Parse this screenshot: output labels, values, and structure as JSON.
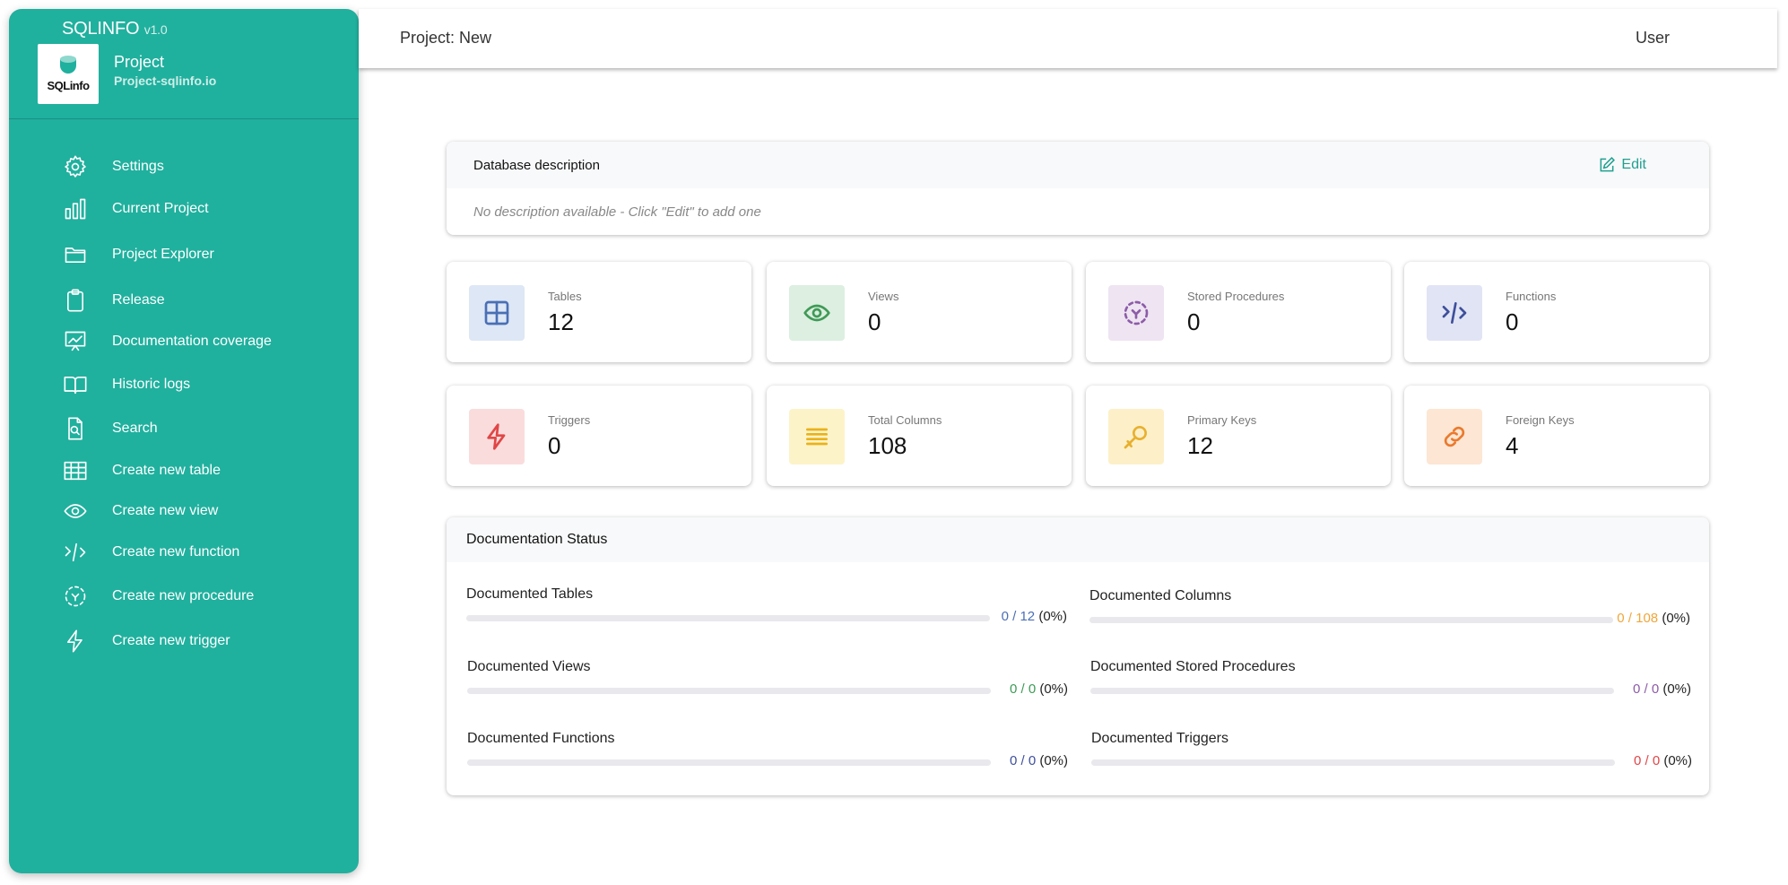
{
  "sidebar": {
    "brand": "SQLINFO",
    "version": "v1.0",
    "logo_text": "SQLinfo",
    "project_name": "Project",
    "project_sub": "Project-sqlinfo.io",
    "items": [
      {
        "label": "Settings",
        "icon": "gear-icon"
      },
      {
        "label": "Current Project",
        "icon": "bar-chart-icon"
      },
      {
        "label": "Project Explorer",
        "icon": "folder-icon"
      },
      {
        "label": "Release",
        "icon": "clipboard-icon"
      },
      {
        "label": "Documentation coverage",
        "icon": "presentation-chart-icon"
      },
      {
        "label": "Historic logs",
        "icon": "book-icon"
      },
      {
        "label": "Search",
        "icon": "file-search-icon"
      },
      {
        "label": "Create new table",
        "icon": "table-icon"
      },
      {
        "label": "Create new view",
        "icon": "eye-icon"
      },
      {
        "label": "Create new function",
        "icon": "code-icon"
      },
      {
        "label": "Create new procedure",
        "icon": "dashed-frame-icon"
      },
      {
        "label": "Create new trigger",
        "icon": "lightning-icon"
      }
    ]
  },
  "header": {
    "title": "Project: New",
    "user": "User"
  },
  "description": {
    "title": "Database description",
    "edit_label": "Edit",
    "empty_text": "No description available - Click \"Edit\" to add one"
  },
  "stats": [
    {
      "label": "Tables",
      "value": "12",
      "icon": "table-icon",
      "color": "#4a6fb5",
      "bg": "#dde7f5"
    },
    {
      "label": "Views",
      "value": "0",
      "icon": "eye-icon",
      "color": "#3f9a57",
      "bg": "#dcefe0"
    },
    {
      "label": "Stored Procedures",
      "value": "0",
      "icon": "dashed-frame-icon",
      "color": "#8c5ca8",
      "bg": "#efe4f2"
    },
    {
      "label": "Functions",
      "value": "0",
      "icon": "code-icon",
      "color": "#3e4f9c",
      "bg": "#e1e4f4"
    },
    {
      "label": "Triggers",
      "value": "0",
      "icon": "lightning-icon",
      "color": "#e04646",
      "bg": "#fadcdc"
    },
    {
      "label": "Total Columns",
      "value": "108",
      "icon": "lines-icon",
      "color": "#e8b21a",
      "bg": "#fdf3c9"
    },
    {
      "label": "Primary Keys",
      "value": "12",
      "icon": "key-icon",
      "color": "#e8b030",
      "bg": "#fdf0c8"
    },
    {
      "label": "Foreign Keys",
      "value": "4",
      "icon": "link-icon",
      "color": "#ea7a2e",
      "bg": "#fde6d3"
    }
  ],
  "doc_status": {
    "title": "Documentation Status",
    "items": [
      {
        "label": "Documented Tables",
        "count": "0 / 12",
        "pct": "(0%)",
        "progress": 0,
        "color": "#4a6fb5"
      },
      {
        "label": "Documented Columns",
        "count": "0 / 108",
        "pct": "(0%)",
        "progress": 0,
        "color": "#f0a63a"
      },
      {
        "label": "Documented Views",
        "count": "0 / 0",
        "pct": "(0%)",
        "progress": 0,
        "color": "#3f9a57"
      },
      {
        "label": "Documented Stored Procedures",
        "count": "0 / 0",
        "pct": "(0%)",
        "progress": 0,
        "color": "#8c5ca8"
      },
      {
        "label": "Documented Functions",
        "count": "0 / 0",
        "pct": "(0%)",
        "progress": 0,
        "color": "#3e4f9c"
      },
      {
        "label": "Documented Triggers",
        "count": "0 / 0",
        "pct": "(0%)",
        "progress": 0,
        "color": "#e04646"
      }
    ]
  }
}
